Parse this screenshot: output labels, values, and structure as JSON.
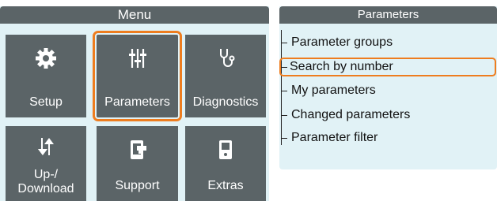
{
  "menu": {
    "title": "Menu",
    "tiles": [
      {
        "id": "setup",
        "label": "Setup",
        "icon": "gear-icon"
      },
      {
        "id": "parameters",
        "label": "Parameters",
        "icon": "sliders-icon",
        "selected": true
      },
      {
        "id": "diagnostics",
        "label": "Diagnostics",
        "icon": "stethoscope-icon"
      },
      {
        "id": "updownload",
        "label_line1": "Up-/",
        "label_line2": "Download",
        "icon": "up-down-arrows-icon"
      },
      {
        "id": "support",
        "label": "Support",
        "icon": "support-icon"
      },
      {
        "id": "extras",
        "label": "Extras",
        "icon": "media-player-icon"
      }
    ]
  },
  "parameters_panel": {
    "title": "Parameters",
    "items": [
      {
        "label": "Parameter groups"
      },
      {
        "label": "Search by number",
        "selected": true
      },
      {
        "label": "My parameters"
      },
      {
        "label": "Changed parameters"
      },
      {
        "label": "Parameter filter"
      }
    ]
  },
  "colors": {
    "tile_bg": "#5b6467",
    "panel_bg": "#e1f2f6",
    "selection": "#ee7d1f"
  }
}
